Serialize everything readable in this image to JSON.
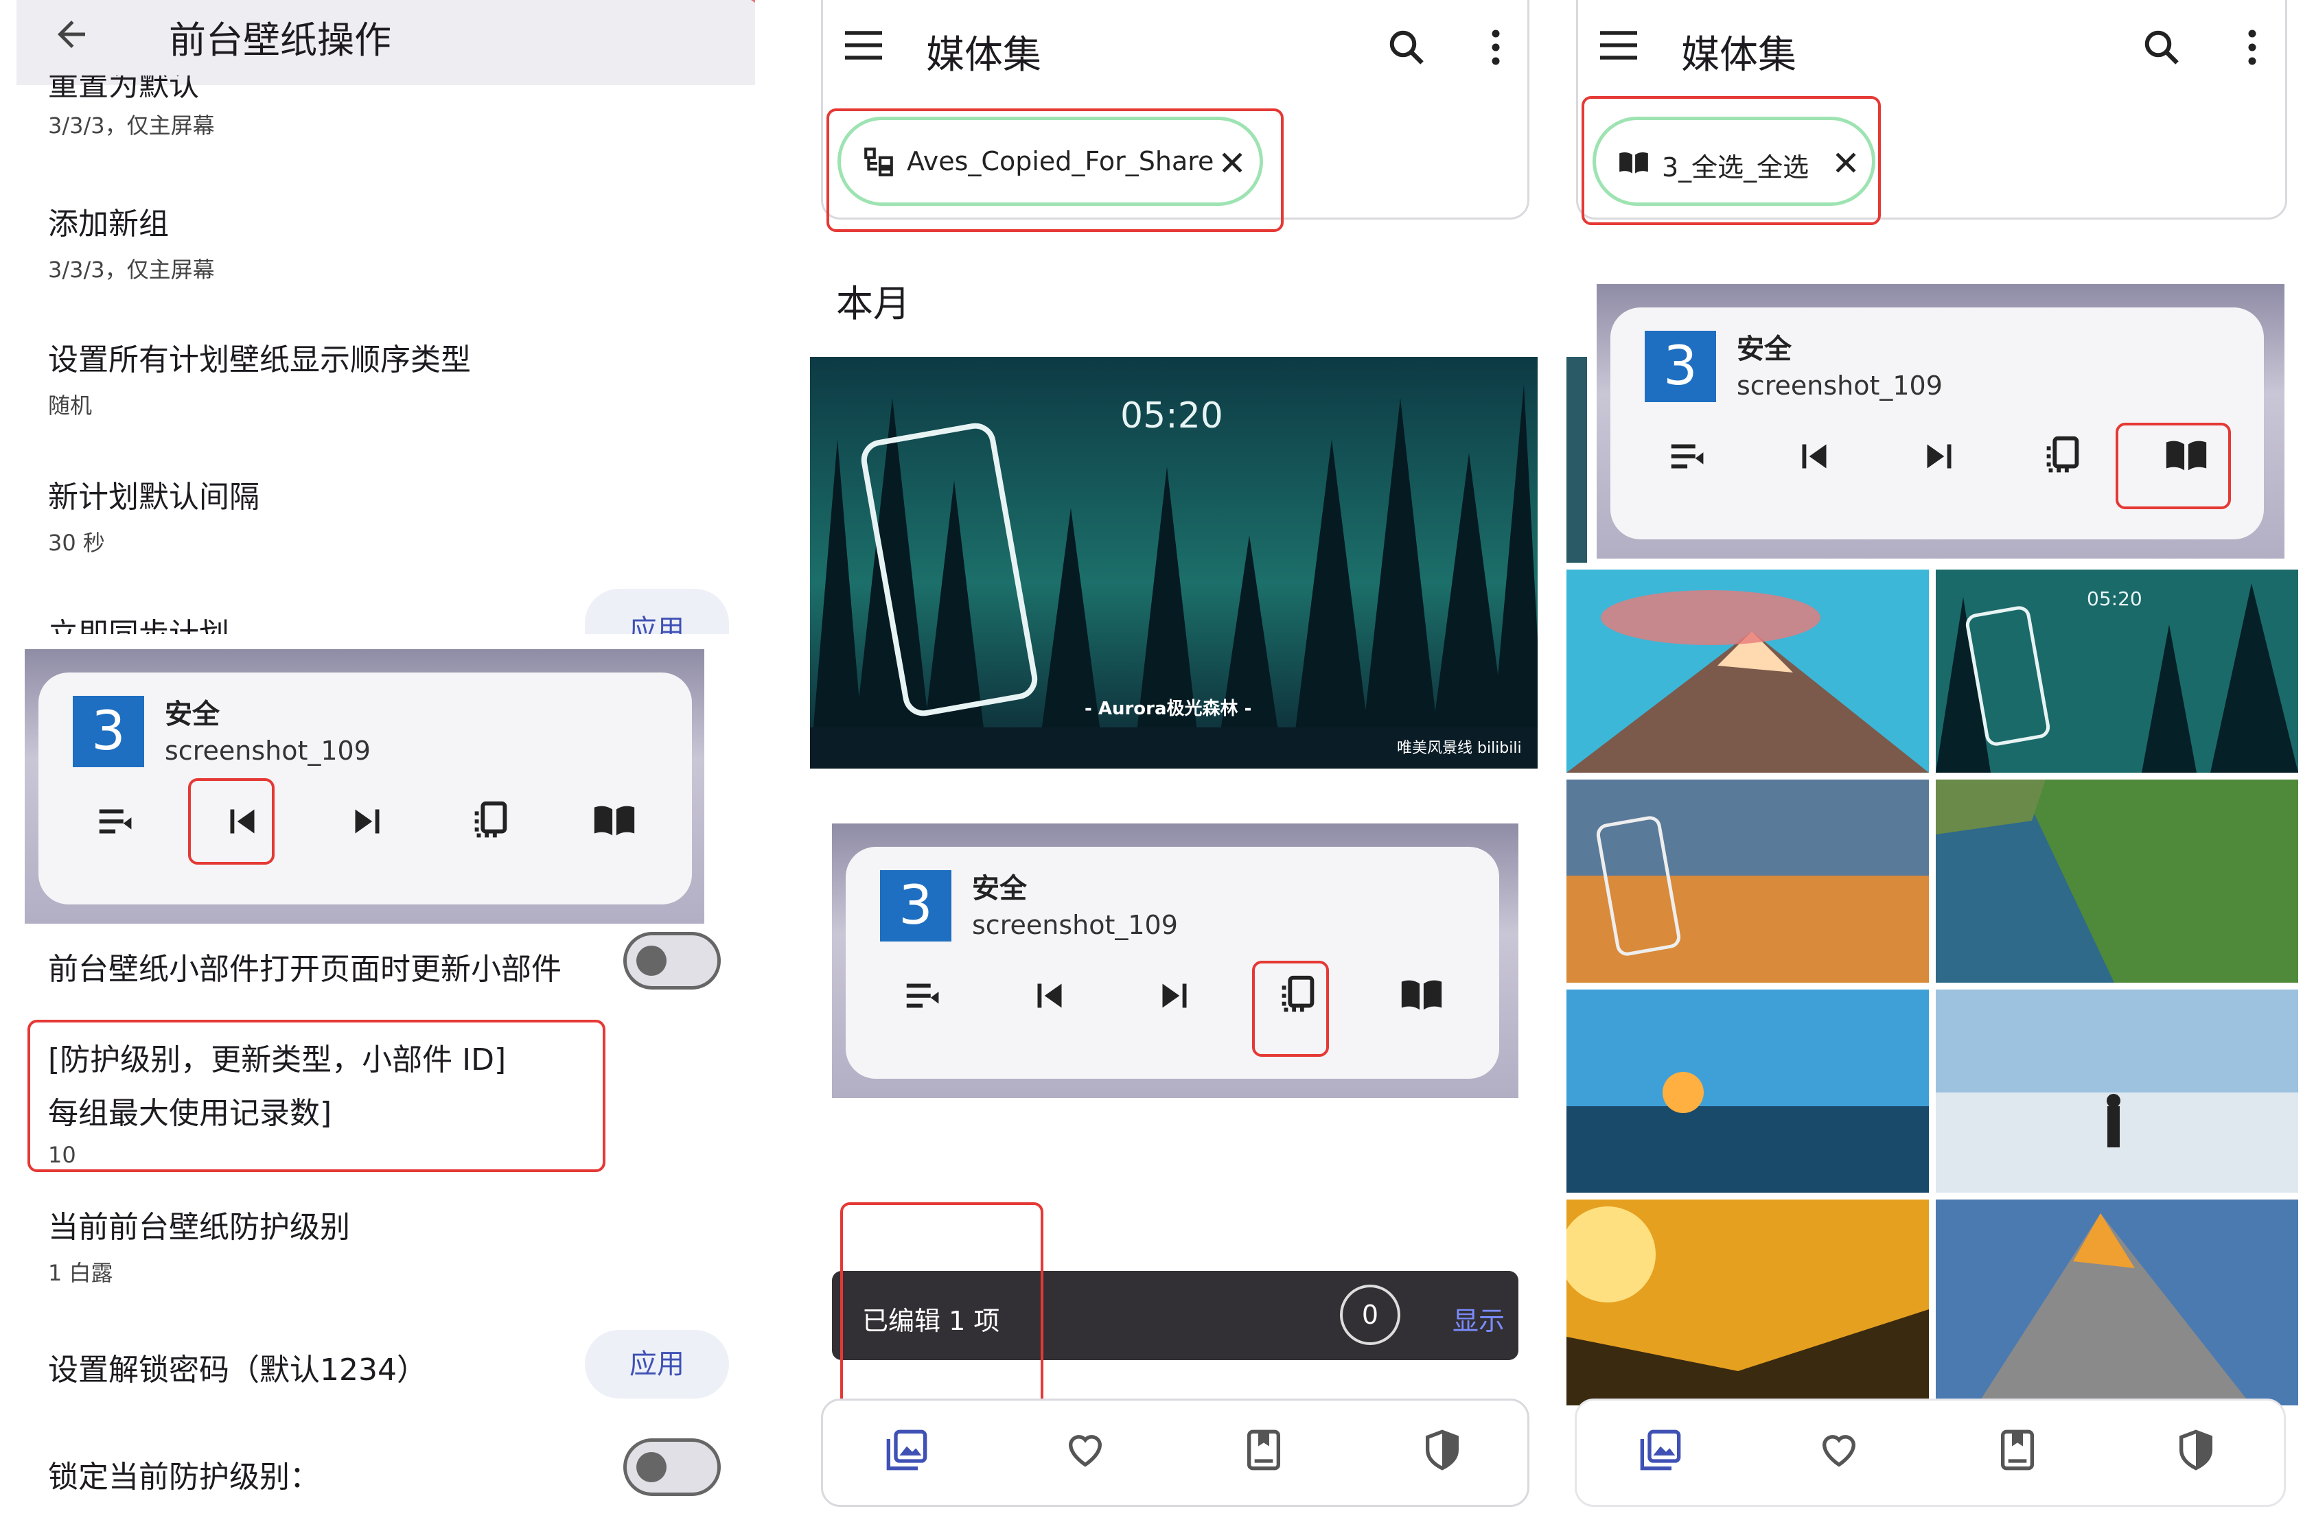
{
  "panel1": {
    "title": "前台壁纸操作",
    "partial_title": "重置为默认",
    "settings": [
      {
        "title": "",
        "sub": "3/3/3，仅主屏幕"
      },
      {
        "title": "添加新组",
        "sub": "3/3/3，仅主屏幕"
      },
      {
        "title": "设置所有计划壁纸显示顺序类型",
        "sub": "随机"
      },
      {
        "title": "新计划默认间隔",
        "sub": "30 秒"
      },
      {
        "title": "立即同步计划",
        "sub": ""
      }
    ],
    "apply_label": "应用",
    "widget": {
      "number": "3",
      "title": "安全",
      "subtitle": "screenshot_109"
    },
    "update_widget_label": "前台壁纸小部件打开页面时更新小部件",
    "record_title_1": "[防护级别，更新类型，小部件 ID]",
    "record_title_2": "每组最大使用记录数]",
    "record_value": "10",
    "level_title": "当前前台壁纸防护级别",
    "level_value": "1 白露",
    "password_title": "设置解锁密码（默认1234）",
    "password_apply": "应用",
    "lock_title": "锁定当前防护级别："
  },
  "panel2": {
    "title": "媒体集",
    "chip_label": "Aves_Copied_For_Share",
    "section": "本月",
    "image_time": "05:20",
    "image_caption": "- Aurora极光森林 -",
    "image_brand": "唯美风景线 bilibili",
    "widget": {
      "number": "3",
      "title": "安全",
      "subtitle": "screenshot_109"
    },
    "snackbar": {
      "text": "已编辑 1 项",
      "count": "0",
      "action": "显示"
    }
  },
  "panel3": {
    "title": "媒体集",
    "chip_label": "3_全选_全选",
    "widget": {
      "number": "3",
      "title": "安全",
      "subtitle": "screenshot_109"
    },
    "thumb_time": "05:20"
  },
  "colors": {
    "accent": "#3f51b5",
    "red": "#e53935",
    "chip": "#9ee3b2",
    "widget_num": "#1e6fc1"
  },
  "icons": [
    "back-icon",
    "menu-icon",
    "search-icon",
    "more-icon",
    "album-icon",
    "close-icon",
    "playlist-icon",
    "skip-previous-icon",
    "skip-next-icon",
    "copy-icon",
    "book-icon",
    "gallery-icon",
    "heart-icon",
    "bookmark-icon",
    "shield-icon"
  ]
}
